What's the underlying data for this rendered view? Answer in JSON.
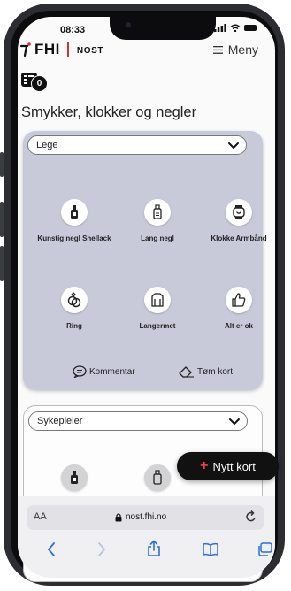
{
  "status": {
    "time": "08:33"
  },
  "header": {
    "logo_text": "FHI",
    "logo_sub": "NOST",
    "menu_label": "Meny"
  },
  "cart": {
    "count": "0"
  },
  "page_title": "Smykker, klokker og negler",
  "card1": {
    "selected_role": "Lege",
    "items": [
      {
        "label": "Kunstig negl Shellack",
        "icon": "nail-polish-icon"
      },
      {
        "label": "Lang negl",
        "icon": "long-nail-icon"
      },
      {
        "label": "Klokke Armbånd",
        "icon": "watch-icon"
      },
      {
        "label": "Ring",
        "icon": "ring-icon"
      },
      {
        "label": "Langermet",
        "icon": "long-sleeve-icon"
      },
      {
        "label": "Alt er ok",
        "icon": "thumbs-up-icon"
      }
    ],
    "comment_label": "Kommentar",
    "clear_label": "Tøm kort"
  },
  "card2": {
    "selected_role": "Sykepleier"
  },
  "fab": {
    "plus": "+",
    "label": "Nytt kort"
  },
  "browser": {
    "aa": "AA",
    "url": "nost.fhi.no"
  },
  "colors": {
    "card_bg": "#c9cad9",
    "accent_red": "#d82e2e",
    "fab_bg": "#111111"
  }
}
